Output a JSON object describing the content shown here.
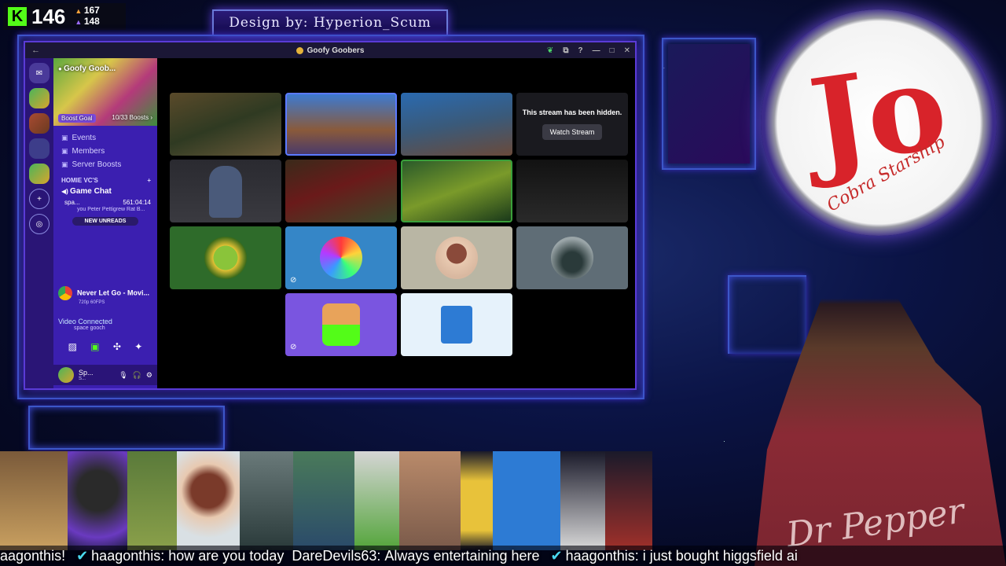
{
  "overlay": {
    "viewer_count": "146",
    "followers": "167",
    "subs": "148",
    "design_credit": "Design by: Hyperion_Scum"
  },
  "window": {
    "title": "Goofy Goobers",
    "back_icon": "←",
    "controls": [
      "leaf-icon",
      "popout-icon",
      "help-icon",
      "minimize-icon",
      "maximize-icon",
      "close-icon"
    ]
  },
  "sidebar": {
    "server_name": "Goofy Goob...",
    "boost_goal": "Boost Goal",
    "boost_count": "10/33 Boosts ›",
    "items": [
      {
        "label": "Events"
      },
      {
        "label": "Members"
      },
      {
        "label": "Server Boosts"
      }
    ],
    "category": "HOMIE VC'S",
    "voice_channel": "Game Chat",
    "voice_user": "spa...",
    "voice_time": "561:04:14",
    "voice_sub": "you Peter Pettigrew Rat B...",
    "new_unreads": "NEW UNREADS",
    "activity_title": "Never Let Go - Movi...",
    "activity_sub": "720p 60FPS",
    "vc_status": "Video Connected",
    "vc_sub": "space gooch",
    "user_short": "Sp...",
    "user_sub": "S..."
  },
  "stream_grid": {
    "hidden_text": "This stream has been hidden.",
    "watch_button": "Watch Stream"
  },
  "ticker": {
    "messages": [
      {
        "name": "",
        "text": "aagonthis!"
      },
      {
        "name": "haagonthis",
        "text": "how are you today"
      },
      {
        "name": "DareDevils63",
        "text": "Always entertaining here"
      },
      {
        "name": "haagonthis",
        "text": "i just bought higgsfield ai"
      }
    ]
  },
  "webcam": {
    "shirt_text": "Dr Pepper"
  },
  "logo": {
    "letter": "Jo",
    "script": "Cobra Starship"
  },
  "colors": {
    "accent": "#5a3bd6",
    "kick_green": "#53fc18",
    "sidebar": "#3b1fb0"
  }
}
